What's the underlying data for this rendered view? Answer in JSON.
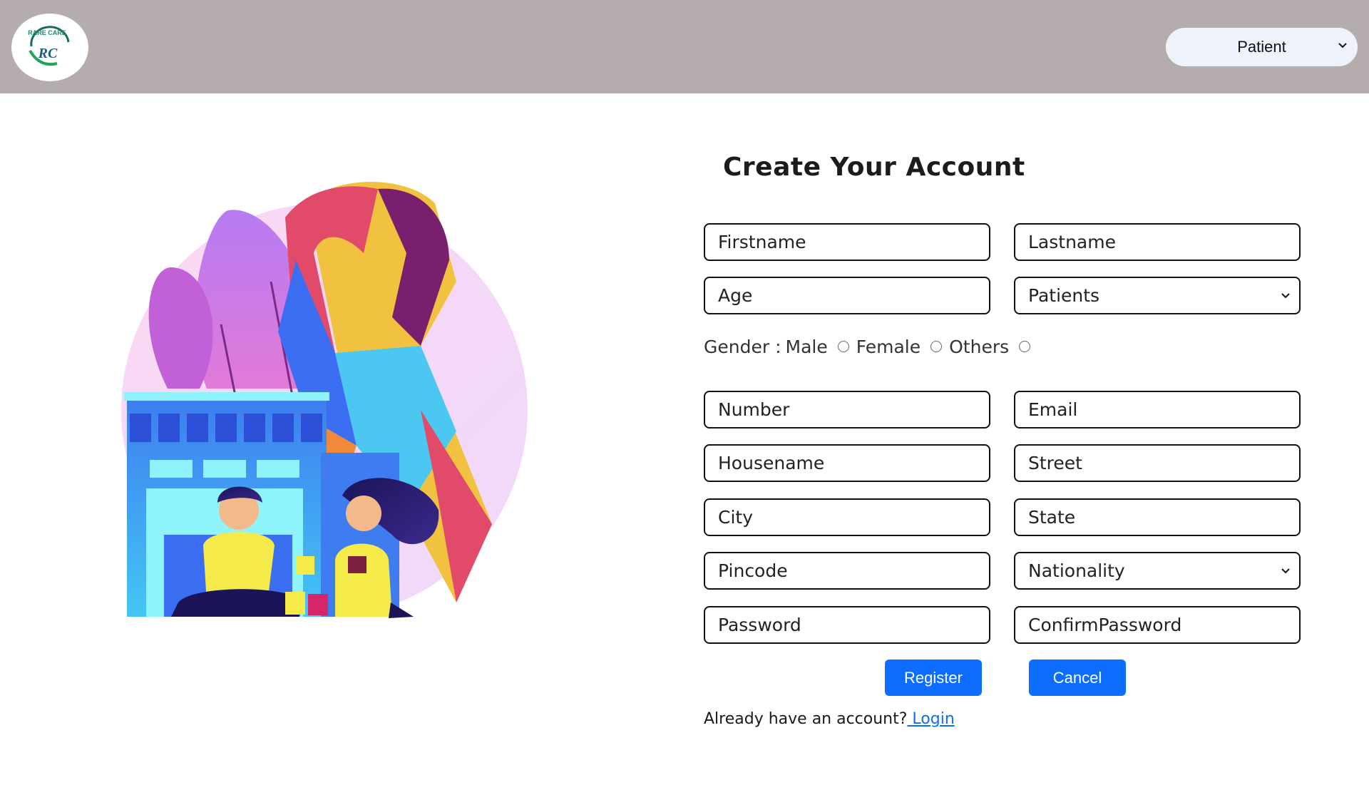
{
  "header": {
    "logo": {
      "text": "RARE CARE",
      "initials": "RC"
    },
    "role_select": {
      "selected": "Patient",
      "icon": "chevron-down-icon"
    }
  },
  "illustration": {
    "description_icon": "awareness-ribbon-illustration"
  },
  "form": {
    "title": "Create Your Account",
    "fields": {
      "firstname": "Firstname",
      "lastname": "Lastname",
      "age": "Age",
      "category": "Patients",
      "number": "Number",
      "email": "Email",
      "housename": "Housename",
      "street": "Street",
      "city": "City",
      "state": "State",
      "pincode": "Pincode",
      "nationality": "Nationality",
      "password": "Password",
      "confirm_password": "ConfirmPassword"
    },
    "gender": {
      "label": "Gender :",
      "options": [
        "Male",
        "Female",
        "Others"
      ]
    },
    "buttons": {
      "register": "Register",
      "cancel": "Cancel"
    },
    "login_prompt": {
      "text": "Already have an account?",
      "link": " Login"
    }
  },
  "colors": {
    "header_bg": "#b5adad",
    "primary": "#0d6efd",
    "select_bg": "#eef3fb"
  }
}
